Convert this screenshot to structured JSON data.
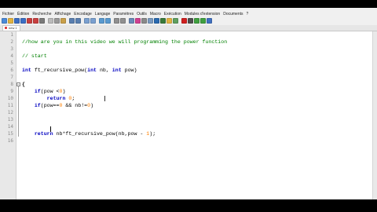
{
  "menu": [
    "Fichier",
    "Édition",
    "Recherche",
    "Affichage",
    "Encodage",
    "Langage",
    "Paramètres",
    "Outils",
    "Macro",
    "Exécution",
    "Modules d'extension",
    "Documents",
    "?"
  ],
  "tab": {
    "label": "new 1"
  },
  "toolbar": {
    "icons": [
      "new-file-icon",
      "open-file-icon",
      "save-icon",
      "save-all-icon",
      "close-icon",
      "close-all-icon",
      "print-icon",
      "cut-icon",
      "copy-icon",
      "paste-icon",
      "undo-icon",
      "redo-icon",
      "find-icon",
      "replace-icon",
      "zoom-in-icon",
      "zoom-out-icon",
      "sync-v-icon",
      "sync-h-icon",
      "word-wrap-icon",
      "show-all-icon",
      "indent-guide-icon",
      "udl-icon",
      "map-icon",
      "function-list-icon",
      "folder-icon",
      "monitor-icon",
      "record-icon",
      "stop-icon",
      "play-icon",
      "play-multiple-icon",
      "save-macro-icon"
    ],
    "colors": [
      "#4a8ad8",
      "#e2b340",
      "#3c6fc4",
      "#3c6fc4",
      "#c84040",
      "#c84040",
      "#7a7a7a",
      "#bbbbbb",
      "#9a9a9a",
      "#c9a04a",
      "#5a7fb0",
      "#5a7fb0",
      "#7aa0d0",
      "#7aa0d0",
      "#5a9ad0",
      "#5a9ad0",
      "#909090",
      "#909090",
      "#6a8ab8",
      "#d04090",
      "#8a8a8a",
      "#7a9ac0",
      "#2a6ab0",
      "#3a7a3a",
      "#e2b340",
      "#60a060",
      "#d02020",
      "#505050",
      "#40a040",
      "#40a040",
      "#4070c0"
    ]
  },
  "editor": {
    "lines": [
      {
        "n": "1",
        "text": ""
      },
      {
        "n": "2",
        "text": "//how are you in this video we will programming the power function"
      },
      {
        "n": "3",
        "text": ""
      },
      {
        "n": "4",
        "text": "// start"
      },
      {
        "n": "5",
        "text": ""
      },
      {
        "n": "6",
        "text": "int ft_recursive_pow(int nb, int pow)"
      },
      {
        "n": "7",
        "text": ""
      },
      {
        "n": "8",
        "text": "{"
      },
      {
        "n": "9",
        "text": "    if(pow <0)"
      },
      {
        "n": "10",
        "text": "        return 0;"
      },
      {
        "n": "11",
        "text": "    if(pow==0 && nb!=0)"
      },
      {
        "n": "12",
        "text": ""
      },
      {
        "n": "13",
        "text": ""
      },
      {
        "n": "14",
        "text": ""
      },
      {
        "n": "15",
        "text": "    return nb*ft_recursive_pow(nb,pow - 1);"
      },
      {
        "n": "16",
        "text": ""
      }
    ],
    "code": {
      "comment1": "//how are you in this video we will programming the power function",
      "comment2": "// start",
      "l6_kw1": "int",
      "l6_mid": " ft_recursive_pow(",
      "l6_kw2": "int",
      "l6_mid2": " nb, ",
      "l6_kw3": "int",
      "l6_end": " pow)",
      "l8": "{",
      "l9_kw": "if",
      "l9_a": "(pow <",
      "l9_num": "0",
      "l9_b": ")",
      "l10_kw": "return",
      "l10_num": "0",
      "l10_end": ";",
      "l11_kw": "if",
      "l11_a": "(pow==",
      "l11_num1": "0",
      "l11_b": " && nb!=",
      "l11_num2": "0",
      "l11_c": ")",
      "l15_kw": "return",
      "l15_a": " nb*ft_recursive_pow(nb,pow - ",
      "l15_num": "1",
      "l15_b": ");"
    },
    "colors": {
      "comment": "#008000",
      "keyword": "#0000c0",
      "number": "#ff8000"
    }
  }
}
